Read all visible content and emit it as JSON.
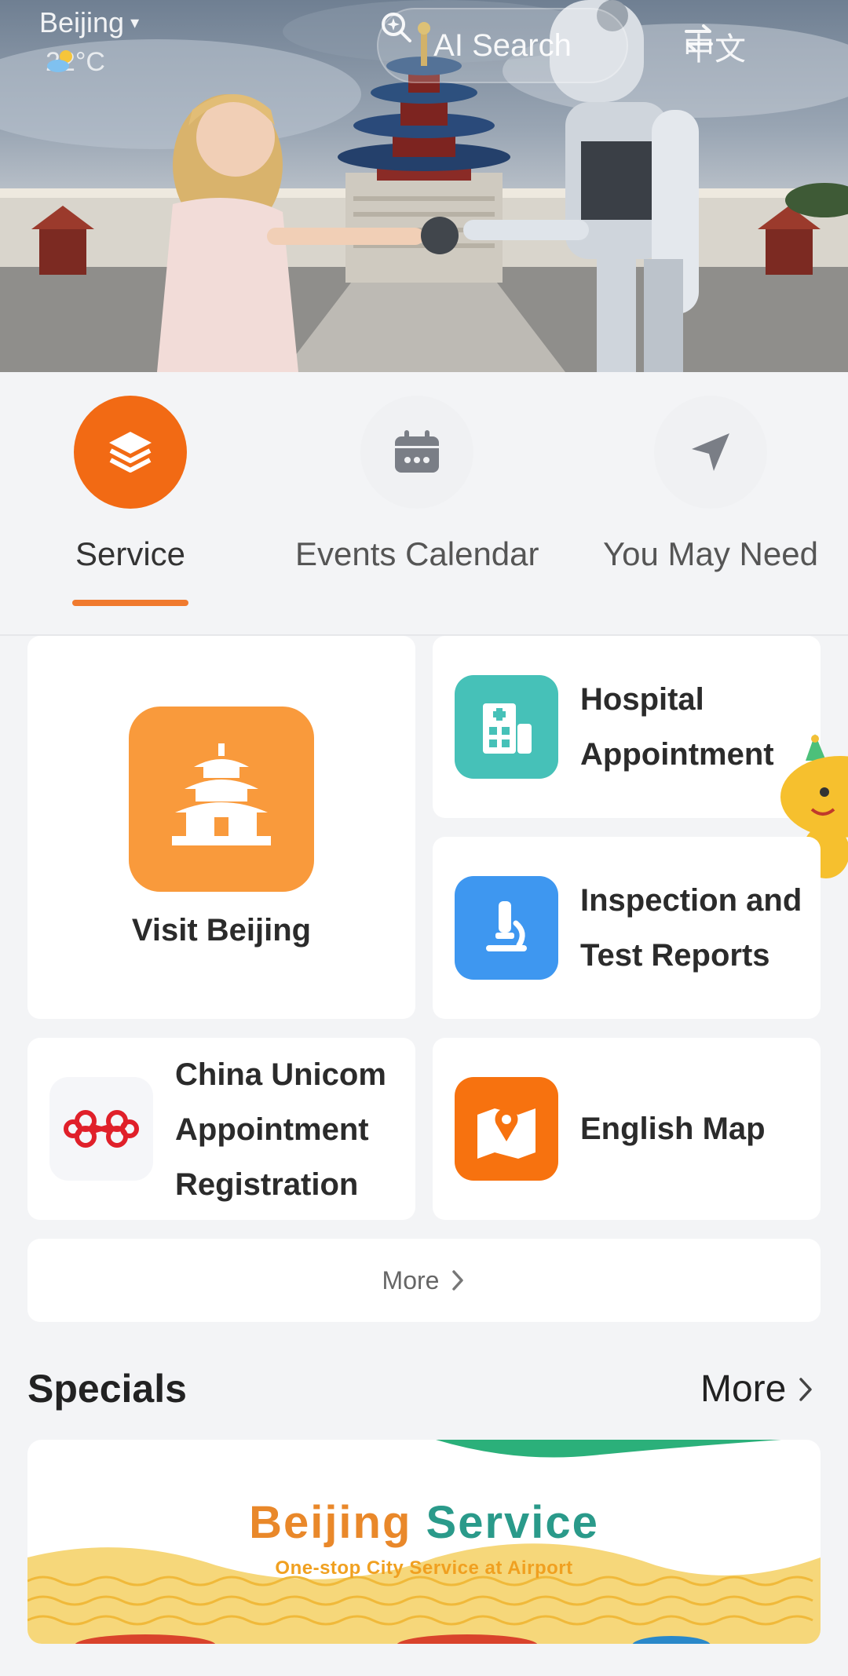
{
  "header": {
    "city": "Beijing",
    "temperature": "22°C",
    "ai_search_label": "AI Search",
    "language_label": "中文"
  },
  "tabs": [
    {
      "label": "Service",
      "icon": "layers-icon",
      "active": true
    },
    {
      "label": "Events Calendar",
      "icon": "calendar-icon",
      "active": false
    },
    {
      "label": "You May Need",
      "icon": "navigation-arrow-icon",
      "active": false
    }
  ],
  "services": {
    "visit_beijing": {
      "label": "Visit Beijing",
      "icon": "temple-of-heaven-icon",
      "color": "#f99a3c"
    },
    "hospital": {
      "line1": "Hospital",
      "line2": "Appointment",
      "icon": "hospital-building-icon",
      "color": "#46c1b8"
    },
    "inspection": {
      "line1": "Inspection and",
      "line2": "Test Reports",
      "icon": "microscope-icon",
      "color": "#3e97f0"
    },
    "unicom": {
      "line1": "China Unicom",
      "line2": "Appointment",
      "line3": "Registration",
      "icon": "china-unicom-logo",
      "color": "#e0202a"
    },
    "english_map": {
      "label": "English Map",
      "icon": "map-pin-icon",
      "color": "#f7720f"
    }
  },
  "more_label": "More",
  "specials": {
    "title": "Specials",
    "more_label": "More",
    "banner_title_part1": "Beijing",
    "banner_title_part2": "Service",
    "banner_subtitle": "One-stop City Service at Airport"
  },
  "colors": {
    "accent": "#f26a14",
    "background": "#f3f4f6"
  }
}
